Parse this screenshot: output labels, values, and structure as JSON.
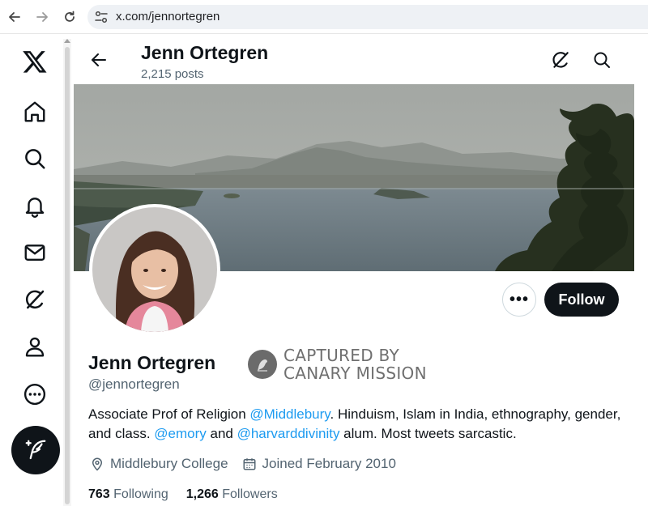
{
  "browser": {
    "url": "x.com/jennortegren",
    "icons": [
      "back-arrow-icon",
      "forward-arrow-icon",
      "reload-icon",
      "site-settings-icon"
    ]
  },
  "sidebar": {
    "items": [
      {
        "name": "x-logo-icon"
      },
      {
        "name": "home-icon"
      },
      {
        "name": "explore-icon"
      },
      {
        "name": "notifications-icon"
      },
      {
        "name": "messages-icon"
      },
      {
        "name": "grok-icon"
      },
      {
        "name": "profile-icon"
      },
      {
        "name": "more-icon"
      }
    ],
    "compose_icon": "compose-quill-icon"
  },
  "header": {
    "name": "Jenn Ortegren",
    "posts": "2,215 posts"
  },
  "profile": {
    "name": "Jenn Ortegren",
    "handle": "@jennortegren",
    "follow_label": "Follow",
    "more_label": "•••",
    "watermark_line1": "CAPTURED BY",
    "watermark_line2": "CANARY MISSION",
    "bio": {
      "p1": "Associate Prof of Religion ",
      "m1": "@Middlebury",
      "p2": ". Hinduism, Islam in India, ethnography, gender, and class. ",
      "m2": "@emory",
      "p3": " and ",
      "m3": "@harvarddivinity",
      "p4": " alum. Most tweets sarcastic."
    },
    "location": "Middlebury College",
    "joined": "Joined February 2010",
    "following_count": "763",
    "following_label": "Following",
    "followers_count": "1,266",
    "followers_label": "Followers"
  },
  "colors": {
    "accent": "#1d9bf0",
    "text_primary": "#0f1419",
    "text_secondary": "#536471"
  }
}
